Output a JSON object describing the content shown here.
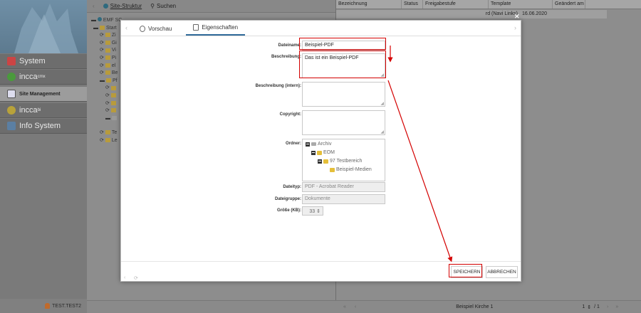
{
  "sidebar": {
    "nav": [
      {
        "label": "System",
        "sup": ""
      },
      {
        "label": "incca",
        "sup": "cmx"
      },
      {
        "label": "Site Management",
        "sup": ""
      },
      {
        "label": "incca",
        "sup": "bi"
      },
      {
        "label": "Info System",
        "sup": ""
      }
    ],
    "user": "TEST.TEST2"
  },
  "tree_pane": {
    "tabs": [
      "Site-Struktur",
      "Suchen"
    ],
    "items": [
      "EMF SC",
      "Start",
      "Zi",
      "Gi",
      "Vi",
      "Pi",
      "el",
      "Be",
      "Pf",
      "",
      "",
      "",
      "",
      "",
      "",
      "Te",
      "Le"
    ]
  },
  "table": {
    "columns": [
      "Bezeichnung",
      "Status",
      "Freigabestufe",
      "Template",
      "Geändert am"
    ],
    "row": {
      "template": "rd (Navi Links)",
      "changed": "16.06.2020"
    },
    "footer": {
      "title": "Beispiel Kirche 1",
      "page": "1",
      "of": "/ 1"
    }
  },
  "modal": {
    "tabs": [
      "Vorschau",
      "Eigenschaften"
    ],
    "fields": {
      "dateiname_label": "Dateiname:",
      "dateiname_value": "Beispiel-PDF",
      "beschreibung_label": "Beschreibung:",
      "beschreibung_value": "Das ist ein Beispiel-PDF",
      "beschreibung_intern_label": "Beschreibung (intern):",
      "copyright_label": "Copyright:",
      "ordner_label": "Ordner:",
      "dateityp_label": "Dateityp:",
      "dateityp_value": "PDF - Acrobat Reader",
      "dateigruppe_label": "Dateigruppe:",
      "dateigruppe_value": "Dokumente",
      "groesse_label": "Größe (KB):",
      "groesse_value": "33"
    },
    "folders": [
      "Archiv",
      "EOM",
      "97 Testbereich",
      "Beispiel-Medien"
    ],
    "buttons": {
      "save": "SPEICHERN",
      "cancel": "ABBRECHEN"
    }
  },
  "colors": {
    "accent": "#2f6a9a",
    "highlight": "#d40000"
  }
}
